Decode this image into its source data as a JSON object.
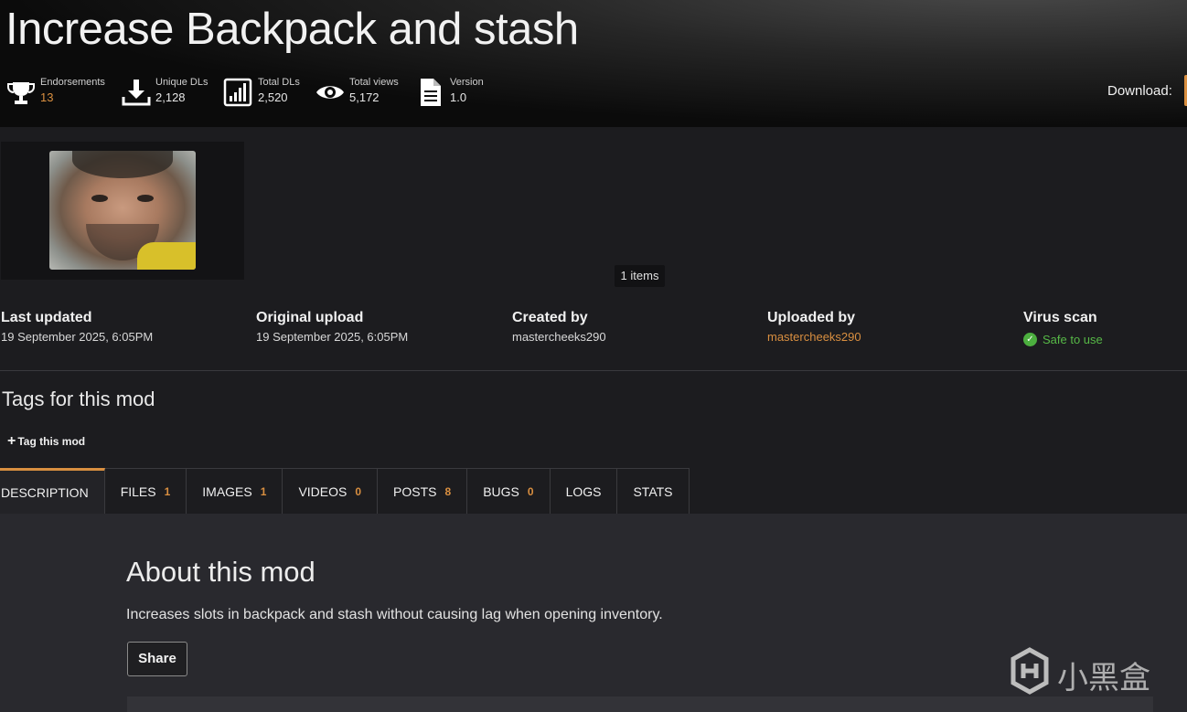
{
  "page": {
    "title": "Increase Backpack and stash"
  },
  "stats": [
    {
      "label": "Endorsements",
      "value": "13",
      "icon": "trophy-icon"
    },
    {
      "label": "Unique DLs",
      "value": "2,128",
      "icon": "download-icon"
    },
    {
      "label": "Total DLs",
      "value": "2,520",
      "icon": "bar-chart-icon"
    },
    {
      "label": "Total views",
      "value": "5,172",
      "icon": "eye-icon"
    },
    {
      "label": "Version",
      "value": "1.0",
      "icon": "document-icon"
    }
  ],
  "download": {
    "label": "Download:"
  },
  "gallery": {
    "items_badge": "1 items"
  },
  "meta": {
    "last_updated": {
      "label": "Last updated",
      "value": "19 September 2025, 6:05PM"
    },
    "original_upload": {
      "label": "Original upload",
      "value": "19 September 2025, 6:05PM"
    },
    "created_by": {
      "label": "Created by",
      "value": "mastercheeks290"
    },
    "uploaded_by": {
      "label": "Uploaded by",
      "value": "mastercheeks290"
    },
    "virus_scan": {
      "label": "Virus scan",
      "value": "Safe to use"
    }
  },
  "tags": {
    "title": "Tags for this mod",
    "button": "Tag this mod"
  },
  "tabs": [
    {
      "label": "DESCRIPTION",
      "count": ""
    },
    {
      "label": "FILES",
      "count": "1"
    },
    {
      "label": "IMAGES",
      "count": "1"
    },
    {
      "label": "VIDEOS",
      "count": "0"
    },
    {
      "label": "POSTS",
      "count": "8"
    },
    {
      "label": "BUGS",
      "count": "0"
    },
    {
      "label": "LOGS",
      "count": ""
    },
    {
      "label": "STATS",
      "count": ""
    }
  ],
  "about": {
    "title": "About this mod",
    "text": "Increases slots in backpack and stash without causing lag when opening inventory.",
    "share": "Share"
  },
  "watermark": {
    "text": "小黑盒"
  },
  "colors": {
    "accent": "#d98f40",
    "safe": "#57b947",
    "background": "#1c1c1f"
  }
}
